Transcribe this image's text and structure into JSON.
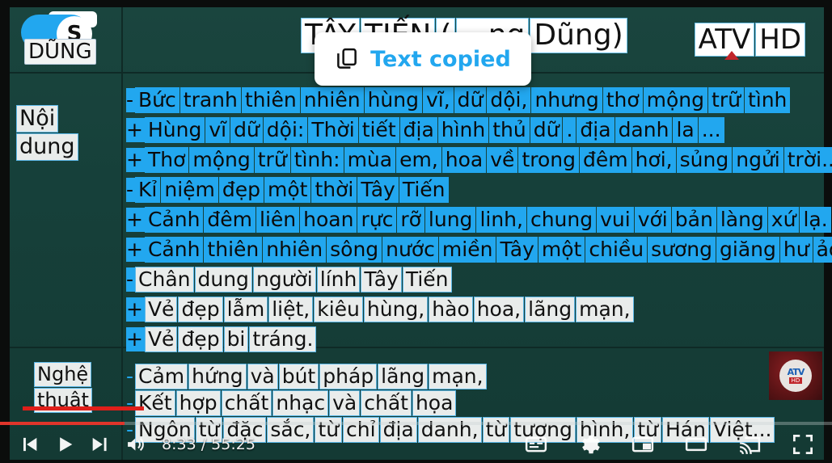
{
  "video": {
    "title_words": [
      "TÂY",
      "TIẾN",
      "(",
      "...ng",
      "Dũng)"
    ],
    "channel_badge": "ATV HD",
    "channel_badge_words": [
      "ATV",
      "HD"
    ],
    "logo_sticker": {
      "letter": "S",
      "name": "DŨNG"
    }
  },
  "toast": {
    "icon": "copy-icon",
    "message": "Text copied"
  },
  "slide": {
    "row1_label_words": [
      "Nội",
      "dung"
    ],
    "row2_label_words": [
      "Nghệ",
      "thuật"
    ],
    "row1_lines": [
      {
        "marker": "-",
        "marker_selected": true,
        "words": [
          "Bức",
          "tranh",
          "thiên",
          "nhiên",
          "hùng",
          "vĩ,",
          "dữ",
          "dội,",
          "nhưng",
          "thơ",
          "mộng",
          "trữ",
          "tình"
        ],
        "selected": true
      },
      {
        "marker": "+",
        "marker_selected": true,
        "words": [
          "Hùng",
          "vĩ",
          "dữ",
          "dội:",
          "Thời",
          "tiết",
          "địa",
          "hình",
          "thủ",
          "dữ",
          ".",
          "địa",
          "danh",
          "la",
          "..."
        ],
        "selected": true
      },
      {
        "marker": "+",
        "marker_selected": true,
        "words": [
          "Thơ",
          "mộng",
          "trữ",
          "tình:",
          "mùa",
          "em,",
          "hoa",
          "về",
          "trong",
          "đêm",
          "hơi,",
          "sủng",
          "ngửi",
          "trời..."
        ],
        "selected": true
      },
      {
        "marker": "-",
        "marker_selected": true,
        "words": [
          "Kỉ",
          "niệm",
          "đẹp",
          "một",
          "thời",
          "Tây",
          "Tiến"
        ],
        "selected": true
      },
      {
        "marker": "+",
        "marker_selected": true,
        "words": [
          "Cảnh",
          "đêm",
          "liên",
          "hoan",
          "rực",
          "rỡ",
          "lung",
          "linh,",
          "chung",
          "vui",
          "với",
          "bản",
          "làng",
          "xứ",
          "lạ."
        ],
        "selected": true
      },
      {
        "marker": "+",
        "marker_selected": true,
        "words": [
          "Cảnh",
          "thiên",
          "nhiên",
          "sông",
          "nước",
          "miền",
          "Tây",
          "một",
          "chiều",
          "sương",
          "giăng",
          "hư",
          "ảo."
        ],
        "selected": true
      },
      {
        "marker": "-",
        "marker_selected": true,
        "words": [
          "Chân",
          "dung",
          "người",
          "lính",
          "Tây",
          "Tiến"
        ],
        "selected": false
      },
      {
        "marker": "+",
        "marker_selected": true,
        "words": [
          "Vẻ",
          "đẹp",
          "lẫm",
          "liệt,",
          "kiêu",
          "hùng,",
          "hào",
          "hoa,",
          "lãng",
          "mạn,"
        ],
        "selected": false
      },
      {
        "marker": "+",
        "marker_selected": true,
        "words": [
          "Vẻ",
          "đẹp",
          "bi",
          "tráng."
        ],
        "selected": false
      }
    ],
    "row2_lines": [
      {
        "marker": "-",
        "marker_selected": false,
        "words": [
          "Cảm",
          "hứng",
          "và",
          "bút",
          "pháp",
          "lãng",
          "mạn,"
        ],
        "selected": false
      },
      {
        "marker": "-",
        "marker_selected": false,
        "words": [
          "Kết",
          "hợp",
          "chất",
          "nhạc",
          "và",
          "chất",
          "họa"
        ],
        "selected": false
      },
      {
        "marker": "-",
        "marker_selected": false,
        "words": [
          "Ngôn",
          "từ",
          "đặc",
          "sắc,",
          "từ",
          "chỉ",
          "địa",
          "danh,",
          "từ",
          "tượng",
          "hình,",
          "từ",
          "Hán",
          "Việt..."
        ],
        "selected": false
      }
    ]
  },
  "player": {
    "time_current": "8:33",
    "time_total": "55:25",
    "time_display": "8:33 / 55:25",
    "progress_percent": 15,
    "controls_left": [
      "previous-icon",
      "play-icon",
      "next-icon",
      "volume-icon"
    ],
    "controls_right": [
      "subtitles-icon",
      "settings-gear-icon",
      "miniplayer-icon",
      "theater-mode-icon",
      "cast-icon",
      "fullscreen-icon"
    ]
  },
  "colors": {
    "accent_blue": "#22a7ef",
    "selection_blue": "#22a7ef",
    "board_green": "#17403a",
    "progress_red": "#e1352b",
    "underline_red": "#e01f1a"
  }
}
